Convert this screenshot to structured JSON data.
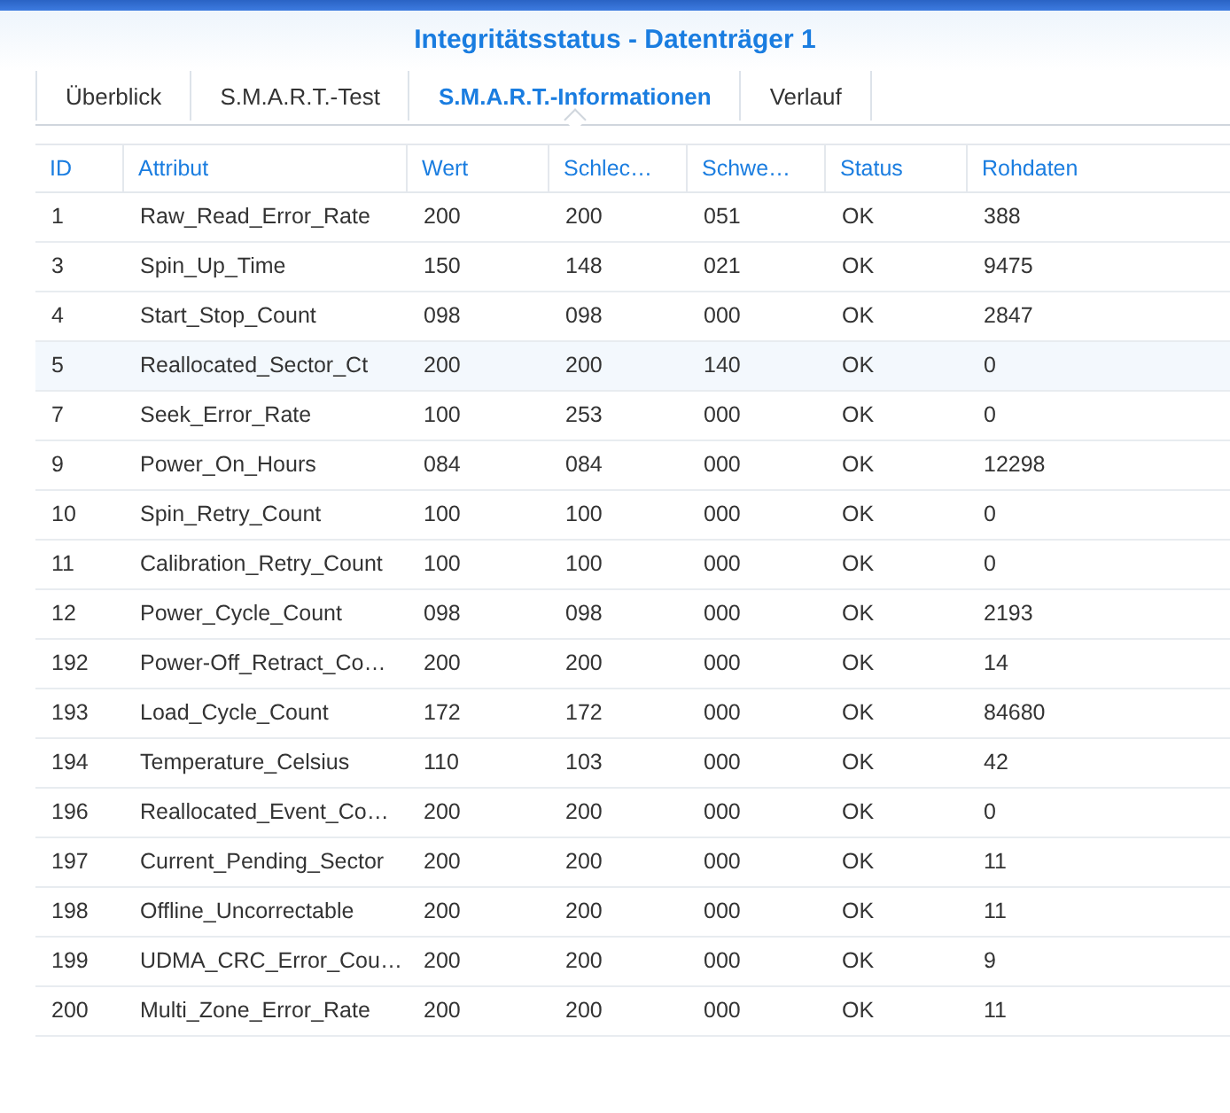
{
  "window": {
    "title": "Integritätsstatus - Datenträger 1"
  },
  "tabs": [
    {
      "label": "Überblick",
      "selected": false
    },
    {
      "label": "S.M.A.R.T.-Test",
      "selected": false
    },
    {
      "label": "S.M.A.R.T.-Informationen",
      "selected": true
    },
    {
      "label": "Verlauf",
      "selected": false
    }
  ],
  "table": {
    "columns": [
      "ID",
      "Attribut",
      "Wert",
      "Schlec…",
      "Schwe…",
      "Status",
      "Rohdaten"
    ],
    "rows": [
      {
        "cells": [
          "1",
          "Raw_Read_Error_Rate",
          "200",
          "200",
          "051",
          "OK",
          "388"
        ],
        "selected": false
      },
      {
        "cells": [
          "3",
          "Spin_Up_Time",
          "150",
          "148",
          "021",
          "OK",
          "9475"
        ],
        "selected": false
      },
      {
        "cells": [
          "4",
          "Start_Stop_Count",
          "098",
          "098",
          "000",
          "OK",
          "2847"
        ],
        "selected": false
      },
      {
        "cells": [
          "5",
          "Reallocated_Sector_Ct",
          "200",
          "200",
          "140",
          "OK",
          "0"
        ],
        "selected": true
      },
      {
        "cells": [
          "7",
          "Seek_Error_Rate",
          "100",
          "253",
          "000",
          "OK",
          "0"
        ],
        "selected": false
      },
      {
        "cells": [
          "9",
          "Power_On_Hours",
          "084",
          "084",
          "000",
          "OK",
          "12298"
        ],
        "selected": false
      },
      {
        "cells": [
          "10",
          "Spin_Retry_Count",
          "100",
          "100",
          "000",
          "OK",
          "0"
        ],
        "selected": false
      },
      {
        "cells": [
          "11",
          "Calibration_Retry_Count",
          "100",
          "100",
          "000",
          "OK",
          "0"
        ],
        "selected": false
      },
      {
        "cells": [
          "12",
          "Power_Cycle_Count",
          "098",
          "098",
          "000",
          "OK",
          "2193"
        ],
        "selected": false
      },
      {
        "cells": [
          "192",
          "Power-Off_Retract_Co…",
          "200",
          "200",
          "000",
          "OK",
          "14"
        ],
        "selected": false
      },
      {
        "cells": [
          "193",
          "Load_Cycle_Count",
          "172",
          "172",
          "000",
          "OK",
          "84680"
        ],
        "selected": false
      },
      {
        "cells": [
          "194",
          "Temperature_Celsius",
          "110",
          "103",
          "000",
          "OK",
          "42"
        ],
        "selected": false
      },
      {
        "cells": [
          "196",
          "Reallocated_Event_Co…",
          "200",
          "200",
          "000",
          "OK",
          "0"
        ],
        "selected": false
      },
      {
        "cells": [
          "197",
          "Current_Pending_Sector",
          "200",
          "200",
          "000",
          "OK",
          "11"
        ],
        "selected": false
      },
      {
        "cells": [
          "198",
          "Offline_Uncorrectable",
          "200",
          "200",
          "000",
          "OK",
          "11"
        ],
        "selected": false
      },
      {
        "cells": [
          "199",
          "UDMA_CRC_Error_Cou…",
          "200",
          "200",
          "000",
          "OK",
          "9"
        ],
        "selected": false
      },
      {
        "cells": [
          "200",
          "Multi_Zone_Error_Rate",
          "200",
          "200",
          "000",
          "OK",
          "11"
        ],
        "selected": false
      }
    ]
  }
}
